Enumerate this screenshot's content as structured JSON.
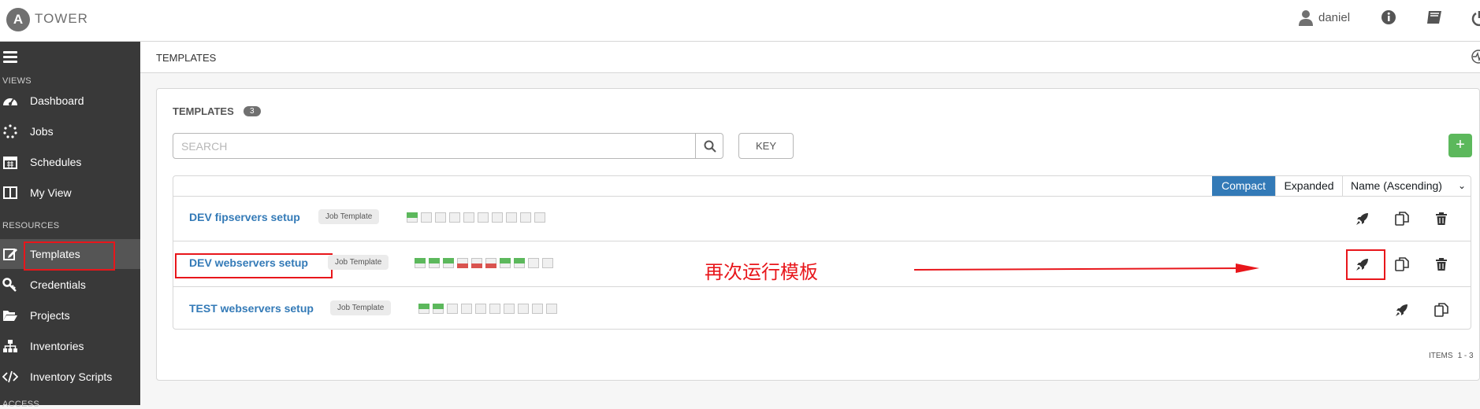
{
  "header": {
    "logo_letter": "A",
    "brand": "TOWER",
    "username": "daniel"
  },
  "sidebar": {
    "views_label": "VIEWS",
    "resources_label": "RESOURCES",
    "access_label": "ACCESS",
    "items": [
      {
        "label": "Dashboard",
        "icon": "dashboard-icon"
      },
      {
        "label": "Jobs",
        "icon": "jobs-icon"
      },
      {
        "label": "Schedules",
        "icon": "calendar-icon"
      },
      {
        "label": "My View",
        "icon": "columns-icon"
      },
      {
        "label": "Templates",
        "icon": "edit-icon"
      },
      {
        "label": "Credentials",
        "icon": "key-icon"
      },
      {
        "label": "Projects",
        "icon": "folder-icon"
      },
      {
        "label": "Inventories",
        "icon": "sitemap-icon"
      },
      {
        "label": "Inventory Scripts",
        "icon": "code-icon"
      }
    ]
  },
  "page": {
    "header_title": "TEMPLATES",
    "panel_title": "TEMPLATES",
    "count": "3",
    "search_placeholder": "SEARCH",
    "key_label": "KEY",
    "add_label": "+",
    "view_compact": "Compact",
    "view_expanded": "Expanded",
    "sort_value": "Name (Ascending)",
    "items_label": "ITEMS",
    "items_range": "1 - 3"
  },
  "templates": [
    {
      "name": "DEV fipservers setup",
      "type": "Job Template",
      "jobs": [
        "ok",
        "none",
        "none",
        "none",
        "none",
        "none",
        "none",
        "none",
        "none",
        "none"
      ]
    },
    {
      "name": "DEV webservers setup",
      "type": "Job Template",
      "jobs": [
        "ok",
        "ok",
        "ok",
        "fail",
        "fail",
        "fail",
        "ok",
        "ok",
        "none",
        "none"
      ]
    },
    {
      "name": "TEST webservers setup",
      "type": "Job Template",
      "jobs": [
        "ok",
        "ok",
        "none",
        "none",
        "none",
        "none",
        "none",
        "none",
        "none",
        "none"
      ]
    }
  ],
  "annotation": {
    "text": "再次运行模板",
    "color": "#e8161b"
  },
  "colors": {
    "primary": "#337ab7",
    "success": "#5cb85c",
    "failure": "#d9534f",
    "sidebar_bg": "#393939"
  }
}
